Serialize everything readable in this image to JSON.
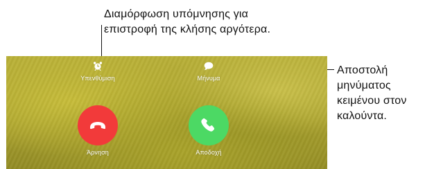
{
  "annotations": {
    "top_line_1": "Διαμόρφωση υπόμνησης για",
    "top_line_2": "επιστροφή της κλήσης αργότερα.",
    "right_line_1": "Αποστολή",
    "right_line_2": "μηνύματος",
    "right_line_3": "κειμένου στον",
    "right_line_4": "καλούντα."
  },
  "call_screen": {
    "remind_label": "Υπενθύμιση",
    "remind_icon": "alarm-clock-icon",
    "message_label": "Μήνυμα",
    "message_icon": "speech-bubble-icon",
    "decline_label": "Άρνηση",
    "decline_icon": "hang-up-phone-icon",
    "accept_label": "Αποδοχή",
    "accept_icon": "phone-icon"
  },
  "colors": {
    "decline": "#f23a3a",
    "accept": "#4cd964",
    "background": "#b3aa33"
  }
}
